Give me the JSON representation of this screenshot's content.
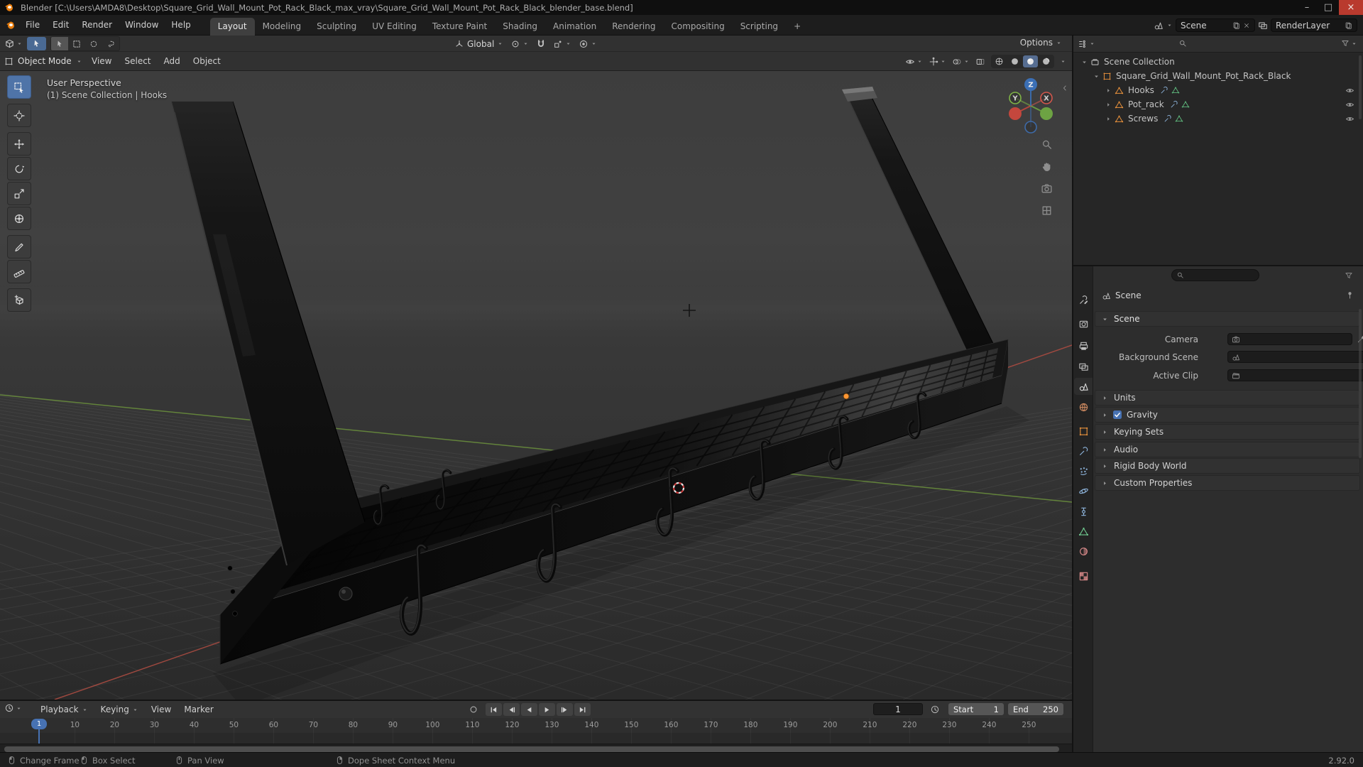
{
  "window": {
    "title": "Blender [C:\\Users\\AMDA8\\Desktop\\Square_Grid_Wall_Mount_Pot_Rack_Black_max_vray\\Square_Grid_Wall_Mount_Pot_Rack_Black_blender_base.blend]",
    "controls": {
      "minimize": "–",
      "maximize": "□",
      "close": "×"
    }
  },
  "menubar": {
    "menus": [
      "File",
      "Edit",
      "Render",
      "Window",
      "Help"
    ],
    "workspaces": [
      "Layout",
      "Modeling",
      "Sculpting",
      "UV Editing",
      "Texture Paint",
      "Shading",
      "Animation",
      "Rendering",
      "Compositing",
      "Scripting"
    ],
    "active_workspace": "Layout",
    "add_tab": "+",
    "scene_field": "Scene",
    "view_layer_field": "RenderLayer"
  },
  "tool_settings": {
    "orientation": "Global",
    "options": "Options"
  },
  "viewport": {
    "mode": "Object Mode",
    "menus": [
      "View",
      "Select",
      "Add",
      "Object"
    ],
    "overlay_line1": "User Perspective",
    "overlay_line2": "(1) Scene Collection | Hooks",
    "gizmo": {
      "x": "X",
      "y": "Y",
      "z": "Z"
    },
    "tools": [
      "select-box",
      "cursor",
      "move",
      "rotate",
      "scale",
      "transform",
      "annotate",
      "measure",
      "add-cube"
    ],
    "active_tool": "select-box",
    "shading_modes": [
      "wireframe",
      "solid",
      "material",
      "rendered"
    ],
    "active_shading": "material"
  },
  "outliner": {
    "root": "Scene Collection",
    "object": "Square_Grid_Wall_Mount_Pot_Rack_Black",
    "children": [
      "Hooks",
      "Pot_rack",
      "Screws"
    ]
  },
  "properties": {
    "tabs": [
      "tool",
      "render",
      "output",
      "view-layer",
      "scene",
      "world",
      "object",
      "modifiers",
      "particles",
      "physics",
      "constraints",
      "data",
      "material",
      "texture"
    ],
    "active_tab": "scene",
    "breadcrumb": "Scene",
    "scene_panel_title": "Scene",
    "fields": [
      {
        "label": "Camera"
      },
      {
        "label": "Background Scene"
      },
      {
        "label": "Active Clip"
      }
    ],
    "panels": [
      {
        "label": "Units"
      },
      {
        "label": "Gravity",
        "checkbox": true
      },
      {
        "label": "Keying Sets"
      },
      {
        "label": "Audio"
      },
      {
        "label": "Rigid Body World"
      },
      {
        "label": "Custom Properties"
      }
    ]
  },
  "timeline": {
    "menus": [
      "Playback",
      "Keying",
      "View",
      "Marker"
    ],
    "current_frame": "1",
    "playhead": "1",
    "start_label": "Start",
    "start_value": "1",
    "end_label": "End",
    "end_value": "250",
    "ruler": [
      10,
      20,
      30,
      40,
      50,
      60,
      70,
      80,
      90,
      100,
      110,
      120,
      130,
      140,
      150,
      160,
      170,
      180,
      190,
      200,
      210,
      220,
      230,
      240,
      250
    ]
  },
  "statusbar": {
    "hints": [
      {
        "icon": "mouse-l",
        "label": "Change Frame"
      },
      {
        "icon": "mouse-l",
        "label": "Box Select"
      },
      {
        "icon": "mouse-m",
        "label": "Pan View"
      },
      {
        "icon": "mouse-r",
        "label": "Dope Sheet Context Menu"
      }
    ],
    "version": "2.92.0"
  },
  "colors": {
    "accent": "#4772b3",
    "axis_x": "#a34a40",
    "axis_y": "#66883c",
    "axis_z": "#3b6fb5",
    "object_orange": "#e8913c",
    "origin_orange": "#ff9633"
  }
}
